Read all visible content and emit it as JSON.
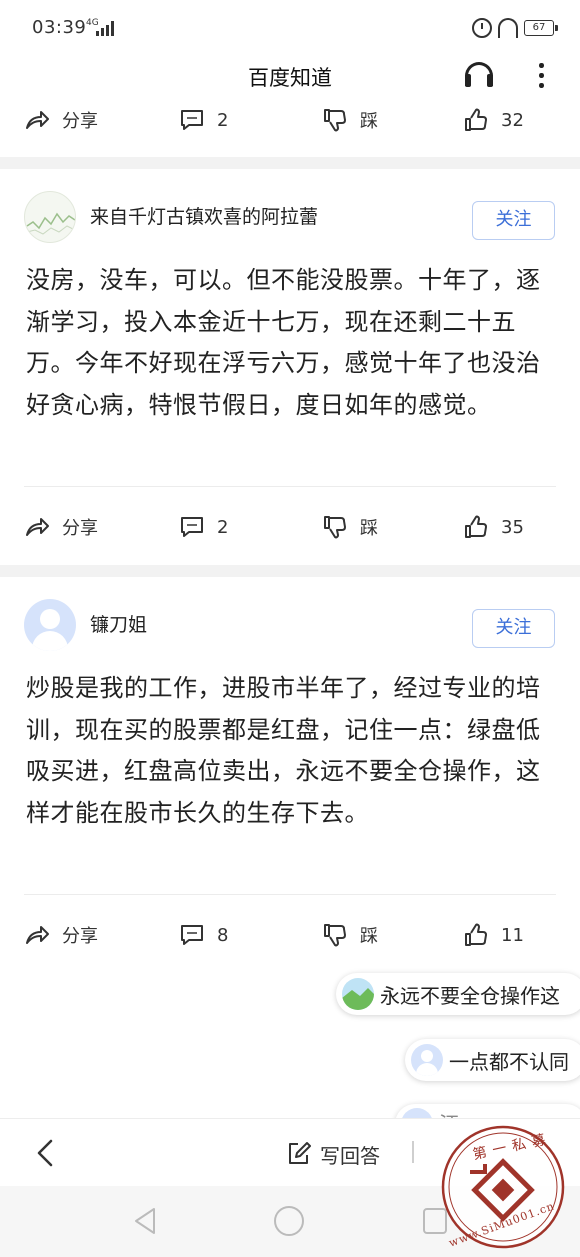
{
  "status_bar": {
    "time": "03:39",
    "network": "4G",
    "battery": "67"
  },
  "topbar": {
    "title": "百度知道"
  },
  "first_actions": {
    "share": "分享",
    "comments": "2",
    "dislike": "踩",
    "likes": "32"
  },
  "answers": [
    {
      "user": "来自千灯古镇欢喜的阿拉蕾",
      "follow_label": "关注",
      "text": "没房，没车，可以。但不能没股票。十年了，逐渐学习，投入本金近十七万，现在还剩二十五万。今年不好现在浮亏六万，感觉十年了也没治好贪心病，特恨节假日，度日如年的感觉。",
      "actions": {
        "share": "分享",
        "comments": "2",
        "dislike": "踩",
        "likes": "35"
      }
    },
    {
      "user": "镰刀姐",
      "follow_label": "关注",
      "text": "炒股是我的工作，进股市半年了，经过专业的培训，现在买的股票都是红盘，记住一点：绿盘低吸买进，红盘高位卖出，永远不要全仓操作，这样才能在股市长久的生存下去。",
      "actions": {
        "share": "分享",
        "comments": "8",
        "dislike": "踩",
        "likes": "11"
      }
    }
  ],
  "reply_bubbles": [
    {
      "text": "永远不要全仓操作这"
    },
    {
      "text": "一点都不认同"
    },
    {
      "text": "汪"
    }
  ],
  "bottom_bar": {
    "write_answer": "写回答"
  },
  "watermark": {
    "text_top": "第一私募",
    "text_bottom": "www.SiMu001.cn"
  },
  "colors": {
    "accent": "#3c6fd8",
    "watermark": "#a0342a"
  }
}
